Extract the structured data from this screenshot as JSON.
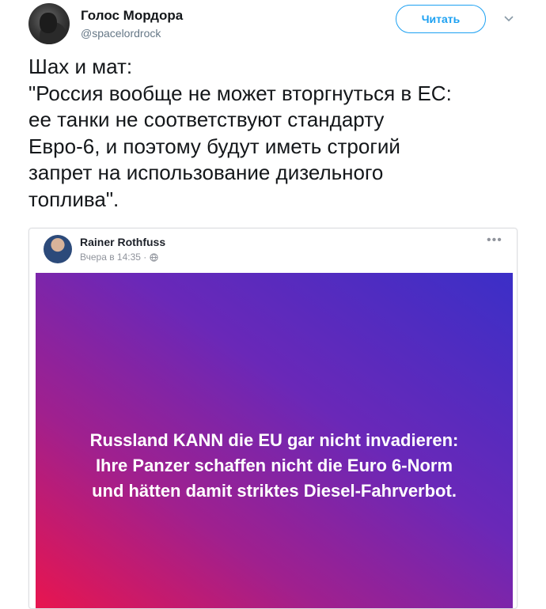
{
  "tweet": {
    "display_name": "Голос Мордора",
    "handle": "@spacelordrock",
    "follow_label": "Читать",
    "text": "Шах и мат:\n\"Россия вообще не может вторгнуться в ЕС:\nее танки не соответствуют стандарту\nЕвро-6, и поэтому будут иметь строгий\nзапрет на использование дизельного\nтоплива\"."
  },
  "embedded_post": {
    "author": "Rainer Rothfuss",
    "timestamp": "Вчера в 14:35 ·",
    "image_caption": "Russland KANN die EU gar nicht invadieren:\nIhre Panzer schaffen nicht die Euro 6-Norm\nund hätten damit striktes Diesel-Fahrverbot."
  },
  "icons": [
    "chevron-down-icon",
    "globe-icon",
    "more-options-icon"
  ],
  "colors": {
    "accent": "#1da1f2",
    "text": "#14171a",
    "muted": "#657786",
    "gradient_start": "#3b2fc7",
    "gradient_end": "#e8154f"
  }
}
